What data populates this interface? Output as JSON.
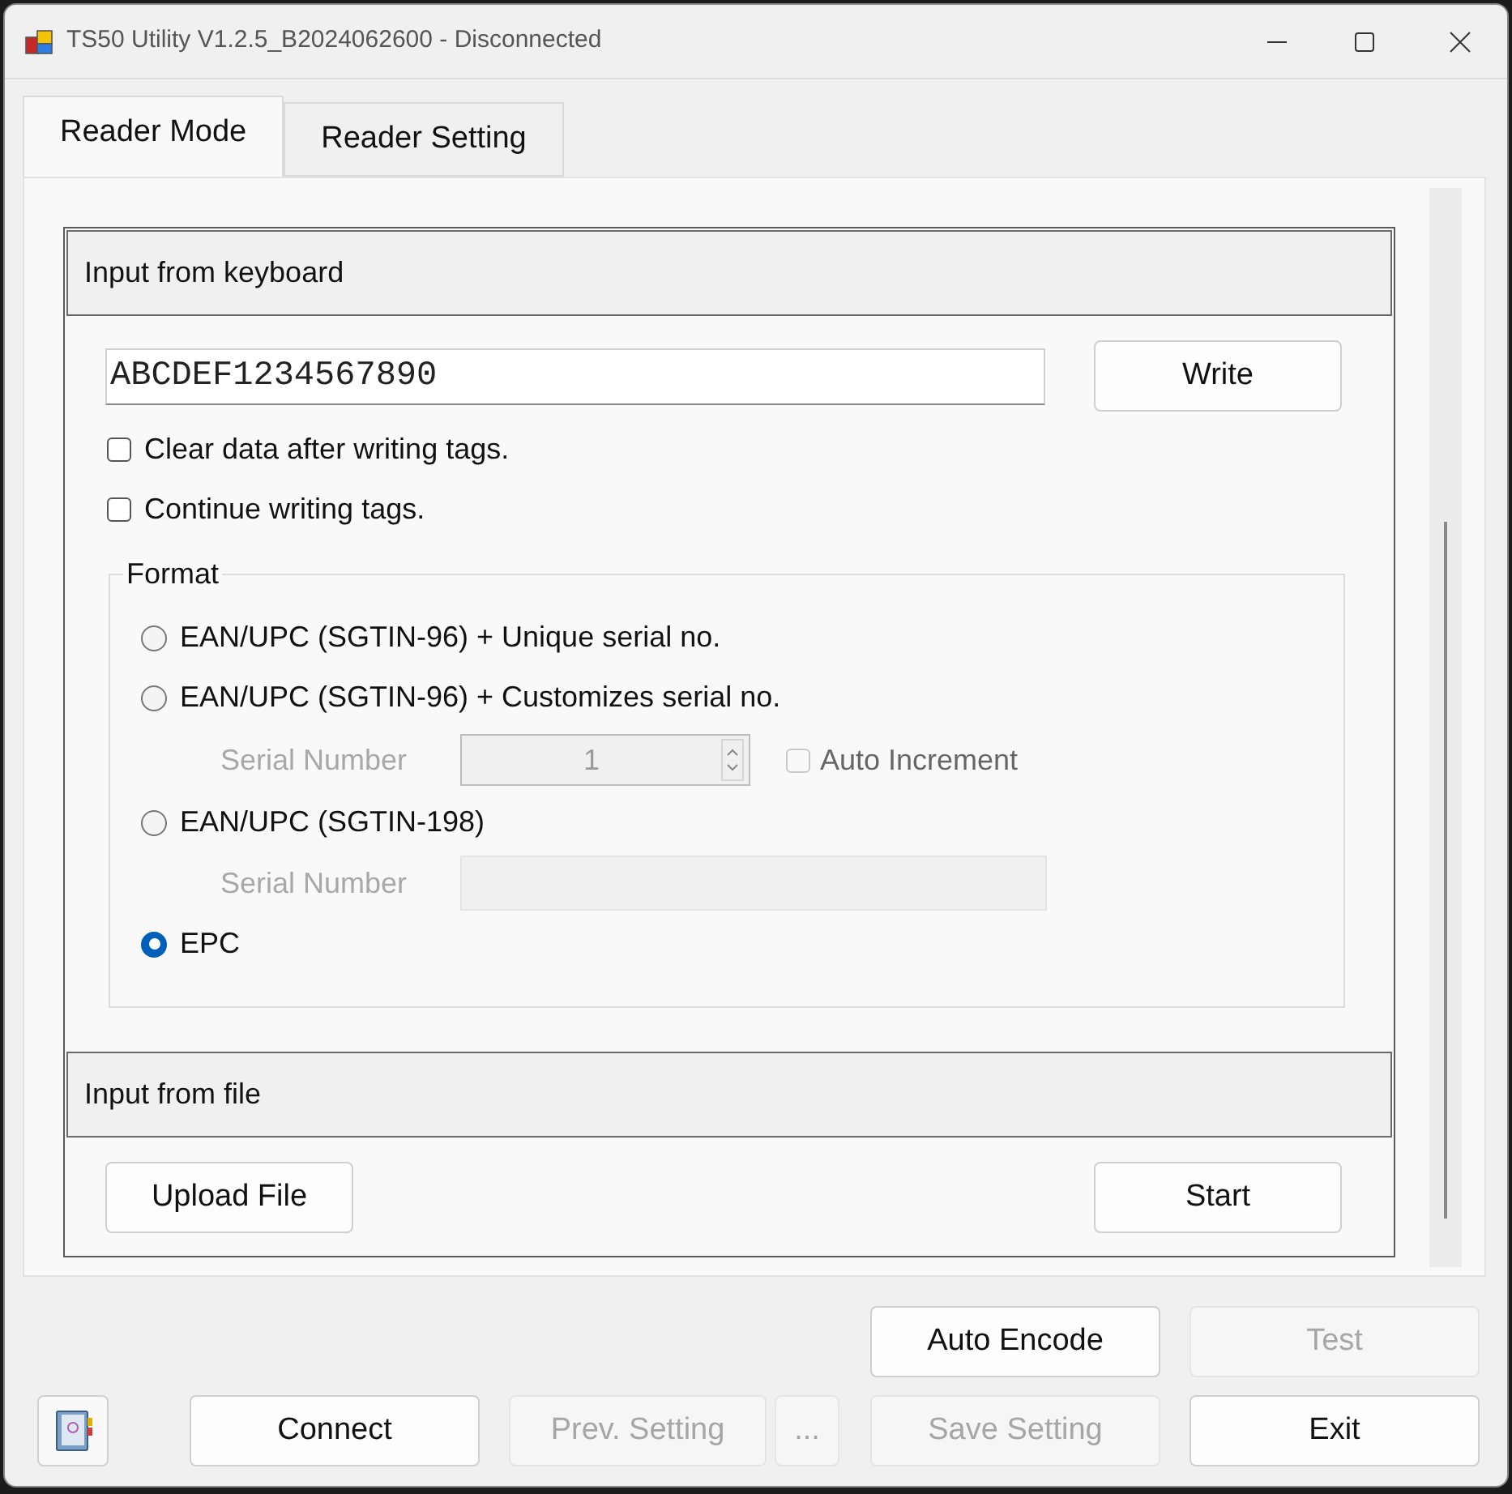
{
  "window": {
    "title": "TS50 Utility V1.2.5_B2024062600 - Disconnected"
  },
  "tabs": [
    {
      "label": "Reader Mode",
      "selected": true
    },
    {
      "label": "Reader Setting",
      "selected": false
    }
  ],
  "keyboard_section": {
    "header": "Input from keyboard",
    "input": {
      "value": "ABCDEF1234567890"
    },
    "write_button": "Write",
    "options": [
      {
        "label": "Clear data after writing tags.",
        "checked": false
      },
      {
        "label": "Continue writing tags.",
        "checked": false
      }
    ],
    "format": {
      "title": "Format",
      "items": [
        {
          "kind": "radio",
          "label": "EAN/UPC (SGTIN-96) + Unique serial no.",
          "selected": false
        },
        {
          "kind": "radio",
          "label": "EAN/UPC (SGTIN-96) + Customizes serial no.",
          "selected": false
        },
        {
          "kind": "spin",
          "label": "Serial Number",
          "value": "1",
          "disabled": true,
          "auto_increment": {
            "label": "Auto Increment",
            "checked": false
          }
        },
        {
          "kind": "radio",
          "label": "EAN/UPC (SGTIN-198)",
          "selected": false
        },
        {
          "kind": "text",
          "label": "Serial Number",
          "disabled": true
        },
        {
          "kind": "radio",
          "label": "EPC",
          "selected": true
        }
      ]
    }
  },
  "file_section": {
    "header": "Input from file",
    "buttons": [
      "Upload File",
      "Start"
    ]
  },
  "footer": {
    "row_1": [
      {
        "label": "Auto Encode",
        "disabled": false
      },
      {
        "label": "Test",
        "disabled": true
      }
    ],
    "row_2": [
      {
        "label": "Connect",
        "disabled": false
      },
      {
        "label": "Prev. Setting",
        "disabled": true
      },
      {
        "label": "...",
        "disabled": true
      },
      {
        "label": "Save Setting",
        "disabled": true
      },
      {
        "label": "Exit",
        "disabled": false
      }
    ]
  }
}
